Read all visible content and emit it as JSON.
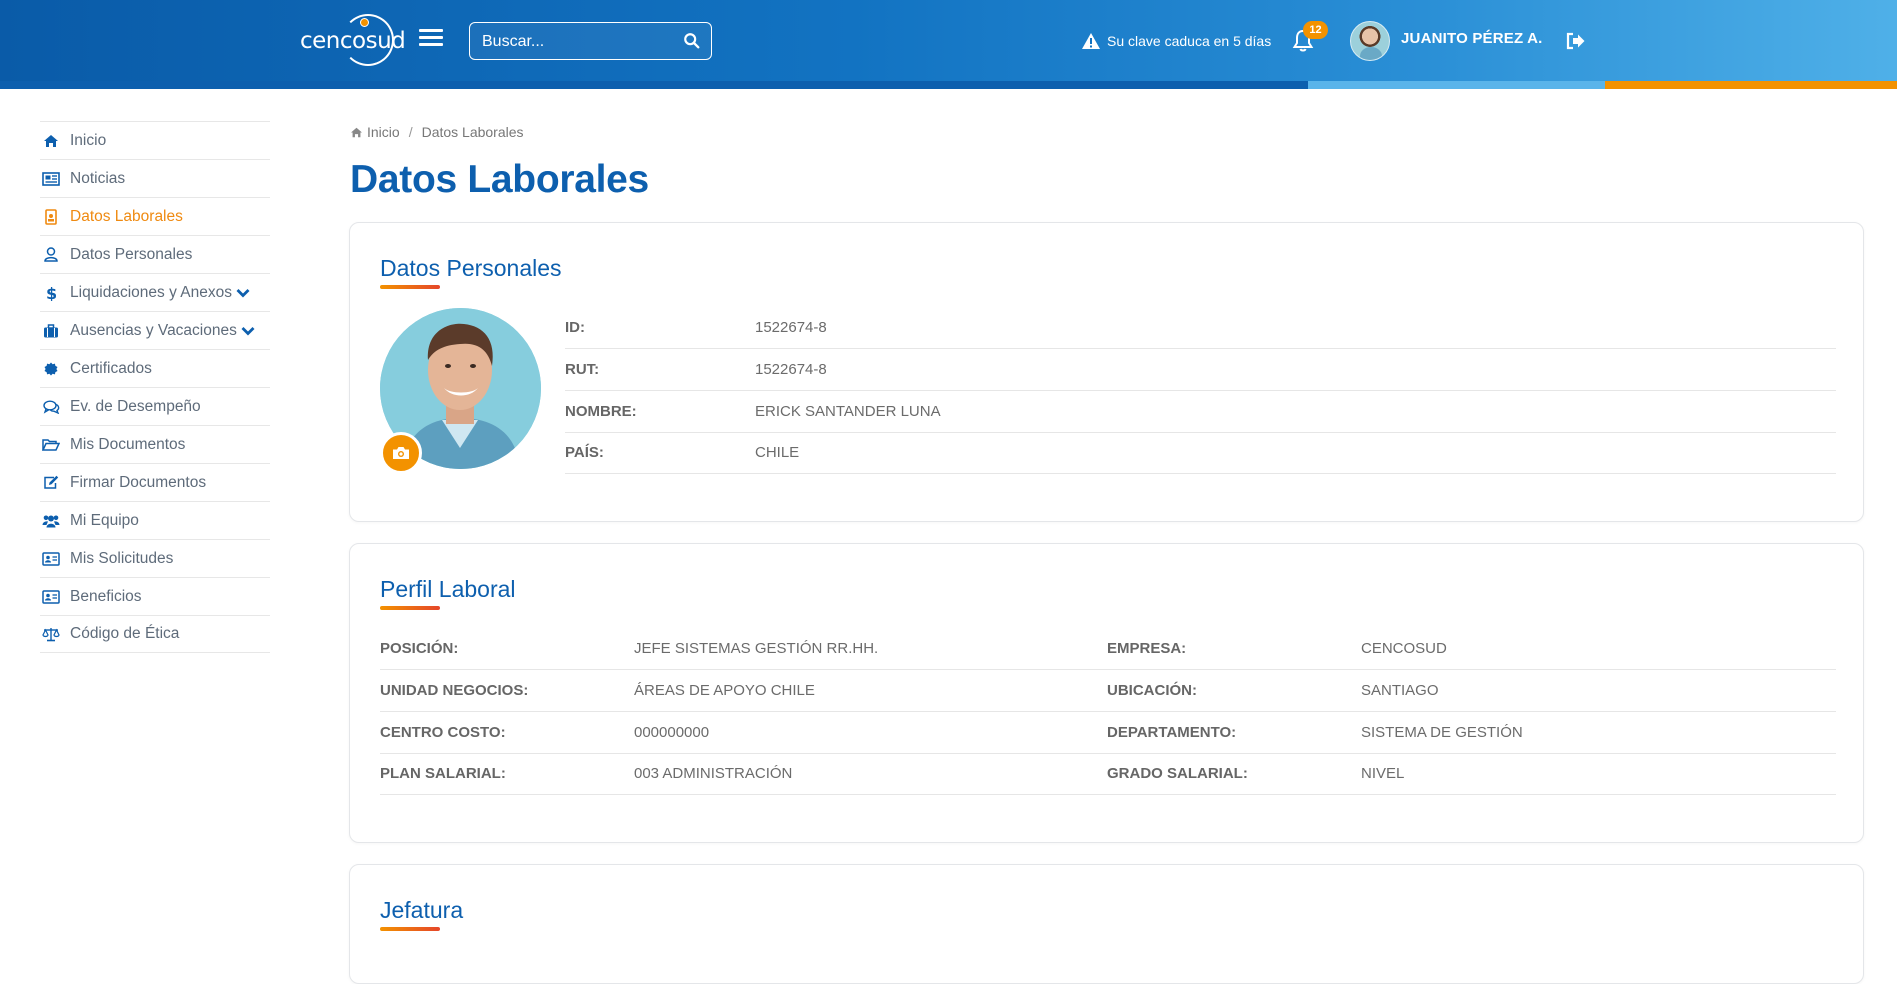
{
  "header": {
    "logo_text": "cencosud",
    "search_placeholder": "Buscar...",
    "password_warning": "Su clave caduca en 5 días",
    "notification_count": "12",
    "user_name": "JUANITO PÉREZ A."
  },
  "sidebar": {
    "items": [
      {
        "label": "Inicio",
        "icon": "home-icon"
      },
      {
        "label": "Noticias",
        "icon": "newspaper-icon"
      },
      {
        "label": "Datos Laborales",
        "icon": "badge-icon",
        "active": true
      },
      {
        "label": "Datos Personales",
        "icon": "user-icon"
      },
      {
        "label": "Liquidaciones y Anexos",
        "icon": "dollar-icon",
        "expandable": true
      },
      {
        "label": "Ausencias y Vacaciones",
        "icon": "suitcase-icon",
        "expandable": true
      },
      {
        "label": "Certificados",
        "icon": "certificate-icon"
      },
      {
        "label": "Ev. de Desempeño",
        "icon": "comments-icon"
      },
      {
        "label": "Mis Documentos",
        "icon": "folder-open-icon"
      },
      {
        "label": "Firmar Documentos",
        "icon": "edit-icon"
      },
      {
        "label": "Mi Equipo",
        "icon": "users-icon"
      },
      {
        "label": "Mis Solicitudes",
        "icon": "id-card-icon"
      },
      {
        "label": "Beneficios",
        "icon": "id-card-icon"
      },
      {
        "label": "Código de Ética",
        "icon": "balance-scale-icon"
      }
    ]
  },
  "breadcrumb": {
    "home": "Inicio",
    "separator": "/",
    "current": "Datos Laborales"
  },
  "page": {
    "title": "Datos Laborales"
  },
  "personal_card": {
    "title": "Datos Personales",
    "fields": [
      {
        "label": "ID:",
        "value": "1522674-8"
      },
      {
        "label": "RUT:",
        "value": "1522674-8"
      },
      {
        "label": "NOMBRE:",
        "value": "ERICK SANTANDER LUNA"
      },
      {
        "label": "PAÍS:",
        "value": "CHILE"
      }
    ]
  },
  "profile_card": {
    "title": "Perfil Laboral",
    "left": [
      {
        "label": "POSICIÓN:",
        "value": "JEFE SISTEMAS GESTIÓN RR.HH."
      },
      {
        "label": "UNIDAD NEGOCIOS:",
        "value": "ÁREAS DE APOYO CHILE"
      },
      {
        "label": "CENTRO COSTO:",
        "value": "000000000"
      },
      {
        "label": "PLAN SALARIAL:",
        "value": "003 ADMINISTRACIÓN"
      }
    ],
    "right": [
      {
        "label": "EMPRESA:",
        "value": "CENCOSUD"
      },
      {
        "label": "UBICACIÓN:",
        "value": "SANTIAGO"
      },
      {
        "label": "DEPARTAMENTO:",
        "value": "SISTEMA DE GESTIÓN"
      },
      {
        "label": "GRADO SALARIAL:",
        "value": "NIVEL"
      }
    ]
  },
  "boss_card": {
    "title": "Jefatura"
  },
  "colors": {
    "primary": "#0d5fae",
    "accent": "#f39200",
    "active_nav": "#ef8a11"
  }
}
